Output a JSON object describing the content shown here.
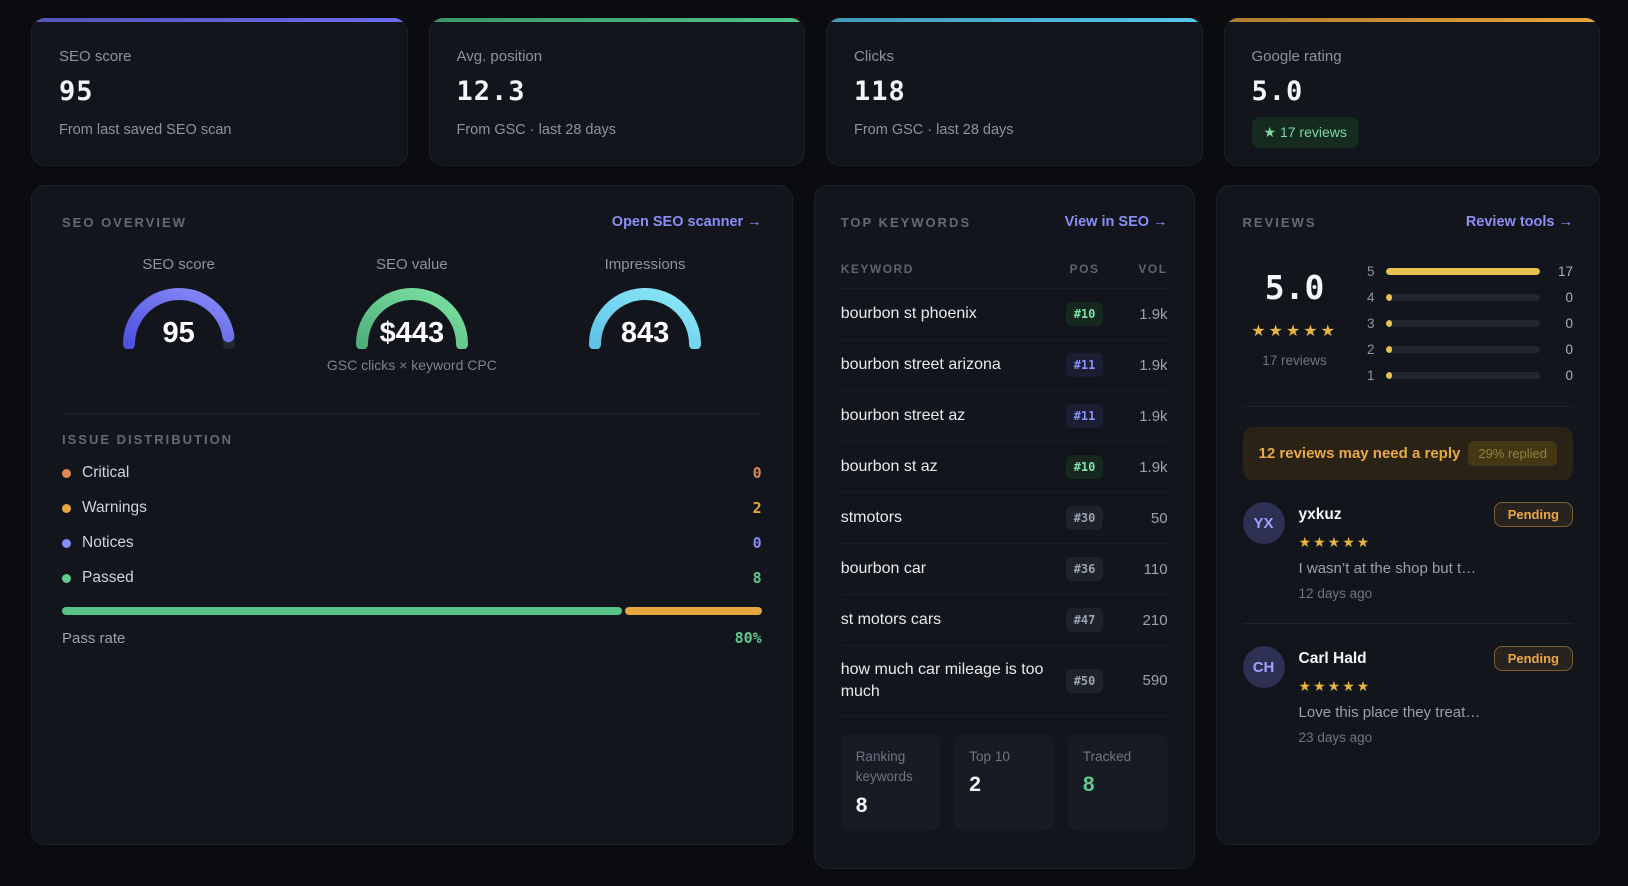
{
  "stat_cards": [
    {
      "label": "SEO score",
      "value": "95",
      "subtitle": "From last saved SEO scan",
      "accent": "#6b6cf0"
    },
    {
      "label": "Avg. position",
      "value": "12.3",
      "subtitle": "From GSC · last 28 days",
      "accent": "#4ec388"
    },
    {
      "label": "Clicks",
      "value": "118",
      "subtitle": "From GSC · last 28 days",
      "accent": "#54c8ef"
    },
    {
      "label": "Google rating",
      "value": "5.0",
      "badge": "★ 17 reviews",
      "accent": "#e9a33a"
    }
  ],
  "seo_overview": {
    "title": "SEO OVERVIEW",
    "link": "Open SEO scanner →",
    "gauges": [
      {
        "label": "SEO score",
        "value": "95",
        "percent": 95,
        "color_start": "#4f52e0",
        "color_end": "#8a8cf8",
        "subtitle": ""
      },
      {
        "label": "SEO value",
        "value": "$443",
        "percent": 100,
        "color_start": "#4faf7c",
        "color_end": "#7ce3a2",
        "subtitle": "GSC clicks × keyword CPC"
      },
      {
        "label": "Impressions",
        "value": "843",
        "percent": 100,
        "color_start": "#5fc3e8",
        "color_end": "#8ee9f8",
        "subtitle": ""
      }
    ],
    "issue_distribution": {
      "title": "ISSUE DISTRIBUTION",
      "items": [
        {
          "label": "Critical",
          "value": "0",
          "color": "#dd8a54"
        },
        {
          "label": "Warnings",
          "value": "2",
          "color": "#e7a73e"
        },
        {
          "label": "Notices",
          "value": "0",
          "color": "#858af5"
        },
        {
          "label": "Passed",
          "value": "8",
          "color": "#62c98f"
        }
      ],
      "bar": {
        "green_pct": 80,
        "amber_pct": 20,
        "green_color": "#58c389",
        "amber_color": "#e7a73e"
      },
      "pass_rate_label": "Pass rate",
      "pass_rate_value": "80%"
    }
  },
  "top_keywords": {
    "title": "TOP KEYWORDS",
    "link": "View in SEO →",
    "columns": {
      "keyword": "KEYWORD",
      "pos": "POS",
      "vol": "VOL"
    },
    "rows": [
      {
        "keyword": "bourbon st phoenix",
        "pos": "#10",
        "vol": "1.9k"
      },
      {
        "keyword": "bourbon street arizona",
        "pos": "#11",
        "vol": "1.9k"
      },
      {
        "keyword": "bourbon street az",
        "pos": "#11",
        "vol": "1.9k"
      },
      {
        "keyword": "bourbon st az",
        "pos": "#10",
        "vol": "1.9k"
      },
      {
        "keyword": "stmotors",
        "pos": "#30",
        "vol": "50"
      },
      {
        "keyword": "bourbon car",
        "pos": "#36",
        "vol": "110"
      },
      {
        "keyword": "st motors cars",
        "pos": "#47",
        "vol": "210"
      },
      {
        "keyword": "how much car mileage is too much",
        "pos": "#50",
        "vol": "590"
      }
    ],
    "stats": [
      {
        "label": "Ranking keywords",
        "value": "8"
      },
      {
        "label": "Top 10",
        "value": "2"
      },
      {
        "label": "Tracked",
        "value": "8"
      }
    ]
  },
  "reviews": {
    "title": "REVIEWS",
    "link": "Review tools →",
    "score": "5.0",
    "stars": "★★★★★",
    "count_label": "17 reviews",
    "distribution": [
      {
        "stars": "5",
        "count": "17",
        "pct": 100
      },
      {
        "stars": "4",
        "count": "0",
        "pct": 0
      },
      {
        "stars": "3",
        "count": "0",
        "pct": 0
      },
      {
        "stars": "2",
        "count": "0",
        "pct": 0
      },
      {
        "stars": "1",
        "count": "0",
        "pct": 0
      }
    ],
    "banner": {
      "text": "12 reviews may need a reply",
      "badge": "29% replied"
    },
    "items": [
      {
        "initials": "YX",
        "name": "yxkuz",
        "status": "Pending",
        "stars": "★★★★★",
        "text": "I wasn’t at the shop but t…",
        "date": "12 days ago"
      },
      {
        "initials": "CH",
        "name": "Carl Hald",
        "status": "Pending",
        "stars": "★★★★★",
        "text": "Love this place they treat…",
        "date": "23 days ago"
      }
    ]
  }
}
